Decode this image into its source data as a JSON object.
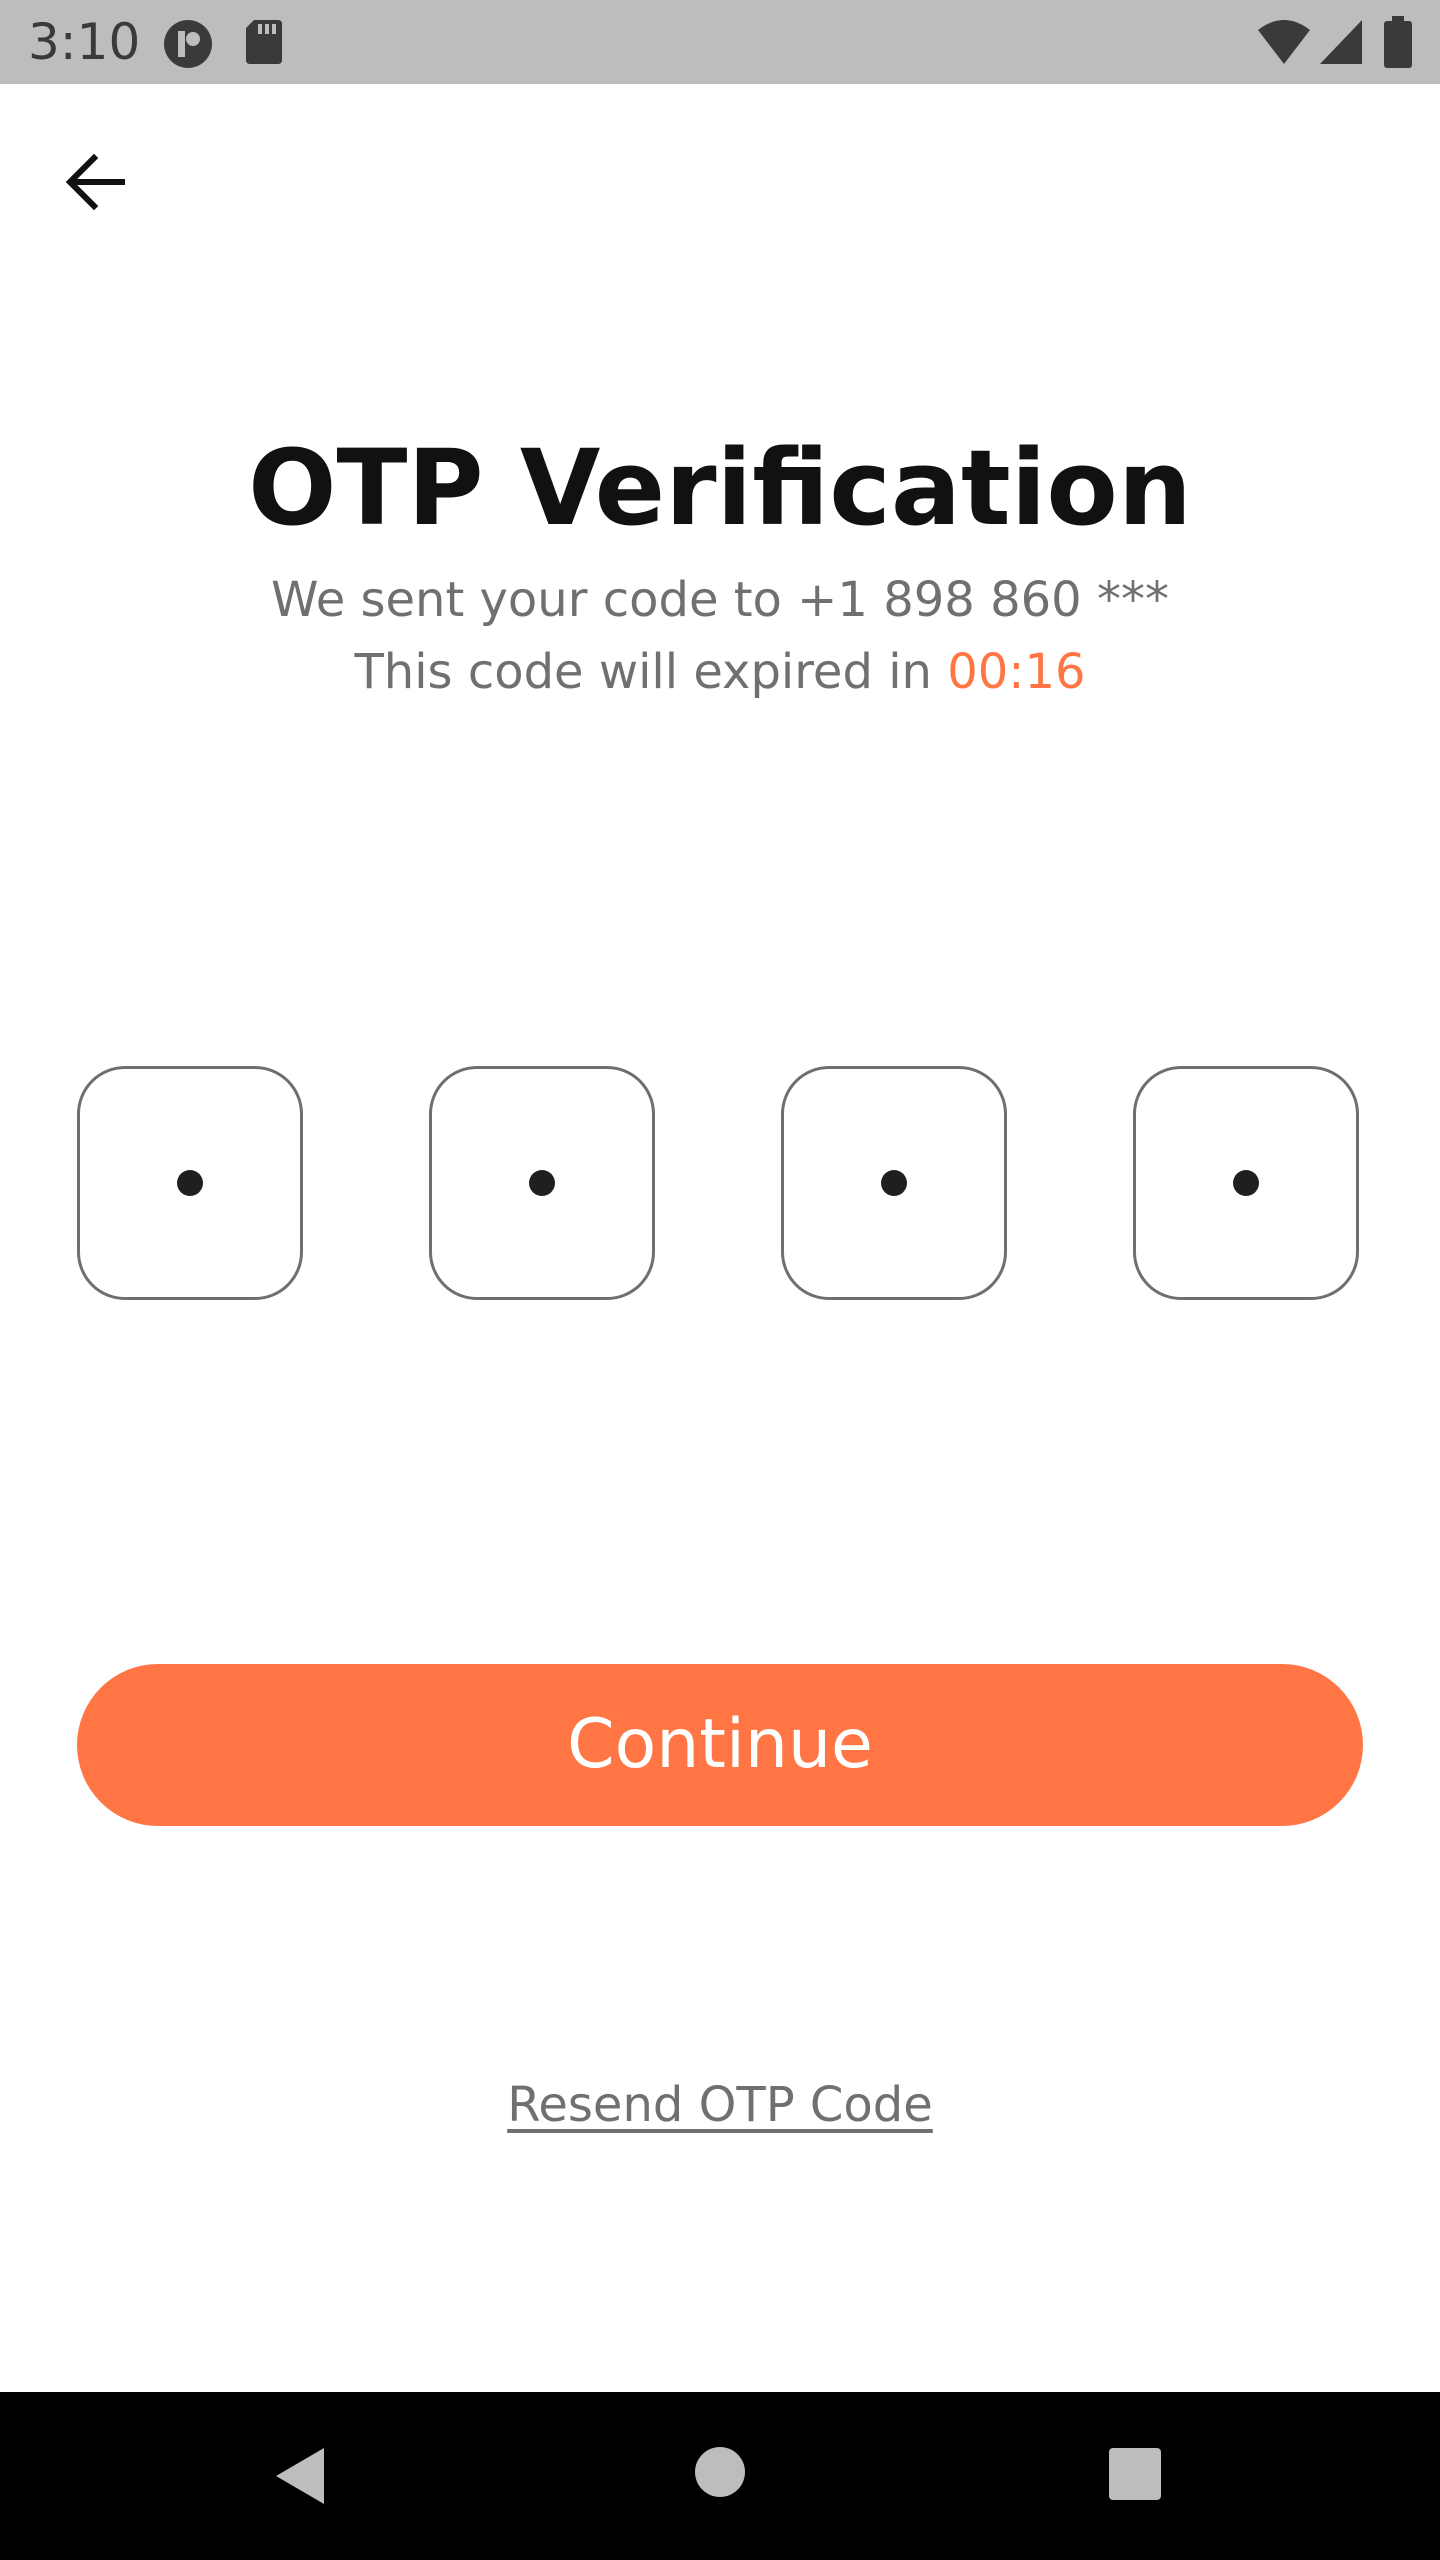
{
  "status_bar": {
    "time": "3:10",
    "icons": [
      "notification-app-icon",
      "sd-card-icon",
      "wifi-icon",
      "cellular-signal-icon",
      "battery-icon"
    ]
  },
  "header": {
    "back_icon": "arrow-left-icon"
  },
  "main": {
    "title": "OTP Verification",
    "subtitle": "We sent your code to +1 898 860 ***",
    "expiry_prefix": "This code will expired in ",
    "expiry_timer": "00:16",
    "otp_digits": [
      "•",
      "•",
      "•",
      "•"
    ],
    "continue_label": "Continue",
    "resend_label": "Resend OTP Code"
  },
  "nav_bar": {
    "buttons": [
      "back-triangle-icon",
      "home-circle-icon",
      "recents-square-icon"
    ]
  },
  "colors": {
    "accent": "#ff7644",
    "text_muted": "#707070",
    "title": "#111111",
    "status_bar_bg": "#bdbdbd",
    "nav_bar_bg": "#000000"
  }
}
